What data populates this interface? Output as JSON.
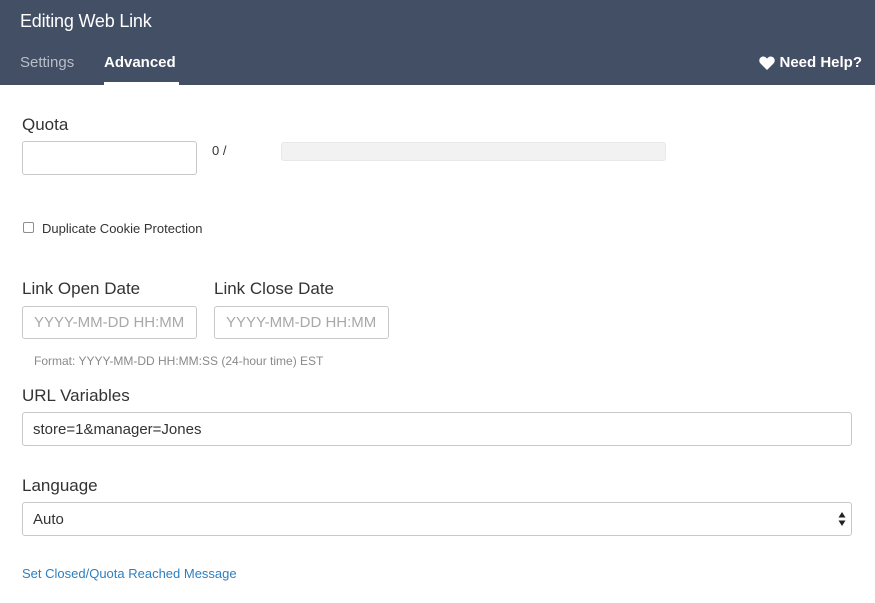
{
  "header": {
    "title": "Editing Web Link",
    "tabs": [
      {
        "label": "Settings",
        "active": false
      },
      {
        "label": "Advanced",
        "active": true
      }
    ],
    "help_label": "Need Help?",
    "help_icon": "heart-icon",
    "background_color": "#434f65"
  },
  "quota": {
    "label": "Quota",
    "value": "",
    "count_text": "0 /",
    "progress_fraction": 0
  },
  "cookie_protection": {
    "label": "Duplicate Cookie Protection",
    "checked": false
  },
  "dates": {
    "open_label": "Link Open Date",
    "open_placeholder": "YYYY-MM-DD HH:MM:SS",
    "close_label": "Link Close Date",
    "close_placeholder": "YYYY-MM-DD HH:MM:SS",
    "format_hint": "Format: YYYY-MM-DD HH:MM:SS (24-hour time) EST"
  },
  "url_variables": {
    "label": "URL Variables",
    "value": "store=1&manager=Jones"
  },
  "language": {
    "label": "Language",
    "selected": "Auto"
  },
  "closed_message_link": "Set Closed/Quota Reached Message",
  "colors": {
    "link": "#2d7fc1",
    "text": "#333333"
  }
}
